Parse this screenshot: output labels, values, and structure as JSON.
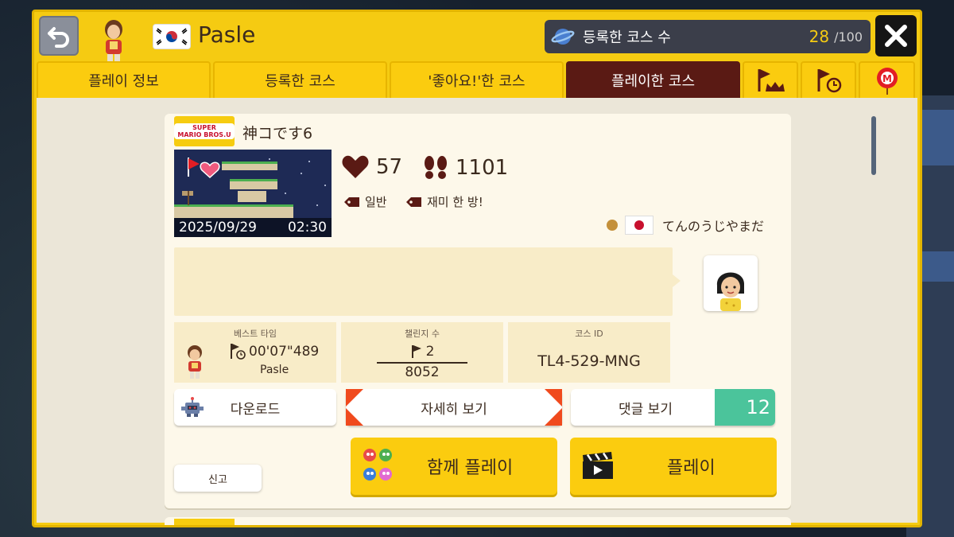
{
  "header": {
    "player_name": "Pasle",
    "country_flag_icon": "korea-flag-icon",
    "course_count_label": "등록한 코스 수",
    "course_count_value": "28",
    "course_count_max": "/100"
  },
  "tabs": [
    {
      "label": "플레이 정보"
    },
    {
      "label": "등록한 코스"
    },
    {
      "label": "'좋아요!'한 코스"
    },
    {
      "label": "플레이한 코스",
      "active": true
    }
  ],
  "icon_tabs": [
    "flag-crown-icon",
    "flag-timer-icon",
    "mario-balloon-icon"
  ],
  "course": {
    "game_badge_line1": "SUPER",
    "game_badge_line2": "MARIO BROS.U",
    "title": "神コです6",
    "upload_date": "2025/09/29",
    "upload_time": "02:30",
    "likes": "57",
    "plays": "1101",
    "tags": [
      "일반",
      "재미 한 방!"
    ],
    "maker_name": "てんのうじやまだ",
    "maker_flag_icon": "japan-flag-icon",
    "best_time_label": "베스트 타임",
    "best_time": "00'07\"489",
    "best_time_holder": "Pasle",
    "challenge_label": "챌린지 수",
    "clears": "2",
    "attempts": "8052",
    "course_id_label": "코스 ID",
    "course_id": "TL4-529-MNG"
  },
  "buttons": {
    "download": "다운로드",
    "details": "자세히 보기",
    "comments": "댓글 보기",
    "comment_count": "12",
    "play_together": "함께 플레이",
    "play": "플레이",
    "report": "신고"
  },
  "colors": {
    "frame_yellow": "#f5cb12",
    "active_tab": "#5a1a14",
    "comment_green": "#4bc49b",
    "card_bg": "#fdf8ea"
  }
}
